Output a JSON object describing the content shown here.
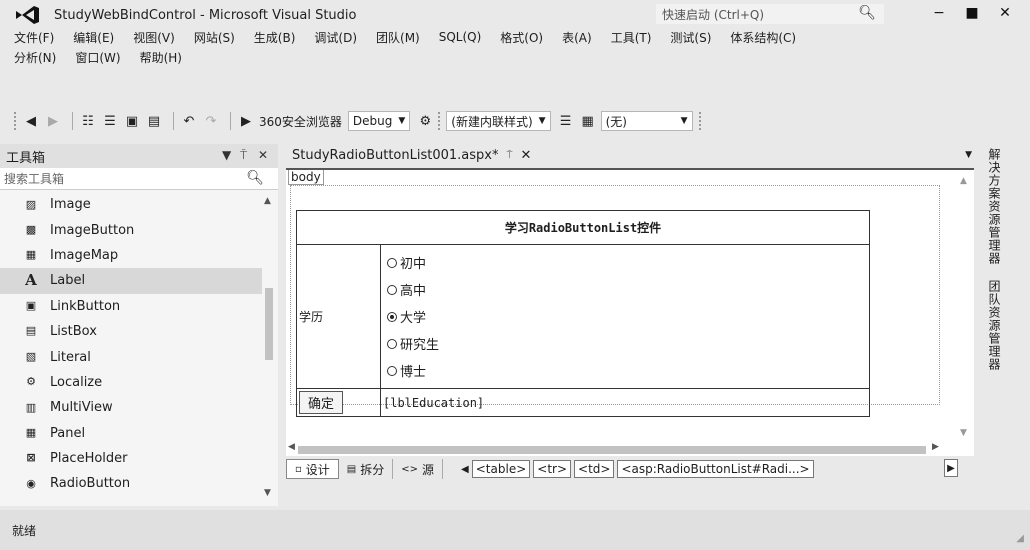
{
  "window": {
    "title": "StudyWebBindControl - Microsoft Visual Studio",
    "quick_launch_placeholder": "快速启动 (Ctrl+Q)"
  },
  "menu": {
    "row1": [
      "文件(F)",
      "编辑(E)",
      "视图(V)",
      "网站(S)",
      "生成(B)",
      "调试(D)",
      "团队(M)",
      "SQL(Q)",
      "格式(O)",
      "表(A)",
      "工具(T)",
      "测试(S)",
      "体系结构(C)"
    ],
    "row2": [
      "分析(N)",
      "窗口(W)",
      "帮助(H)"
    ]
  },
  "toolbar": {
    "browser": "360安全浏览器",
    "config": "Debug",
    "style_target": "(新建内联样式)",
    "style_value": "(无)"
  },
  "toolbox": {
    "title": "工具箱",
    "search_placeholder": "搜索工具箱",
    "items": [
      {
        "label": "Image",
        "icon": "image-icon"
      },
      {
        "label": "ImageButton",
        "icon": "image-button-icon"
      },
      {
        "label": "ImageMap",
        "icon": "image-map-icon"
      },
      {
        "label": "Label",
        "icon": "label-icon"
      },
      {
        "label": "LinkButton",
        "icon": "link-button-icon"
      },
      {
        "label": "ListBox",
        "icon": "list-box-icon"
      },
      {
        "label": "Literal",
        "icon": "literal-icon"
      },
      {
        "label": "Localize",
        "icon": "localize-icon"
      },
      {
        "label": "MultiView",
        "icon": "multi-view-icon"
      },
      {
        "label": "Panel",
        "icon": "panel-icon"
      },
      {
        "label": "PlaceHolder",
        "icon": "placeholder-icon"
      },
      {
        "label": "RadioButton",
        "icon": "radio-button-icon"
      }
    ],
    "selected_index": 3
  },
  "editor": {
    "tab_label": "StudyRadioButtonList001.aspx*",
    "body_tag": "body",
    "table_title": "学习RadioButtonList控件",
    "field_label": "学历",
    "options": [
      "初中",
      "高中",
      "大学",
      "研究生",
      "博士"
    ],
    "selected_option": "大学",
    "confirm_label": "确定",
    "result_label": "[lblEducation]"
  },
  "view_bar": {
    "design": "设计",
    "split": "拆分",
    "source": "源",
    "crumbs": [
      "<table>",
      "<tr>",
      "<td>",
      "<asp:RadioButtonList#Radi...>"
    ]
  },
  "side_panels": {
    "solution_explorer": "解决方案资源管理器",
    "team_explorer": "团队资源管理器"
  },
  "status": {
    "text": "就绪"
  }
}
